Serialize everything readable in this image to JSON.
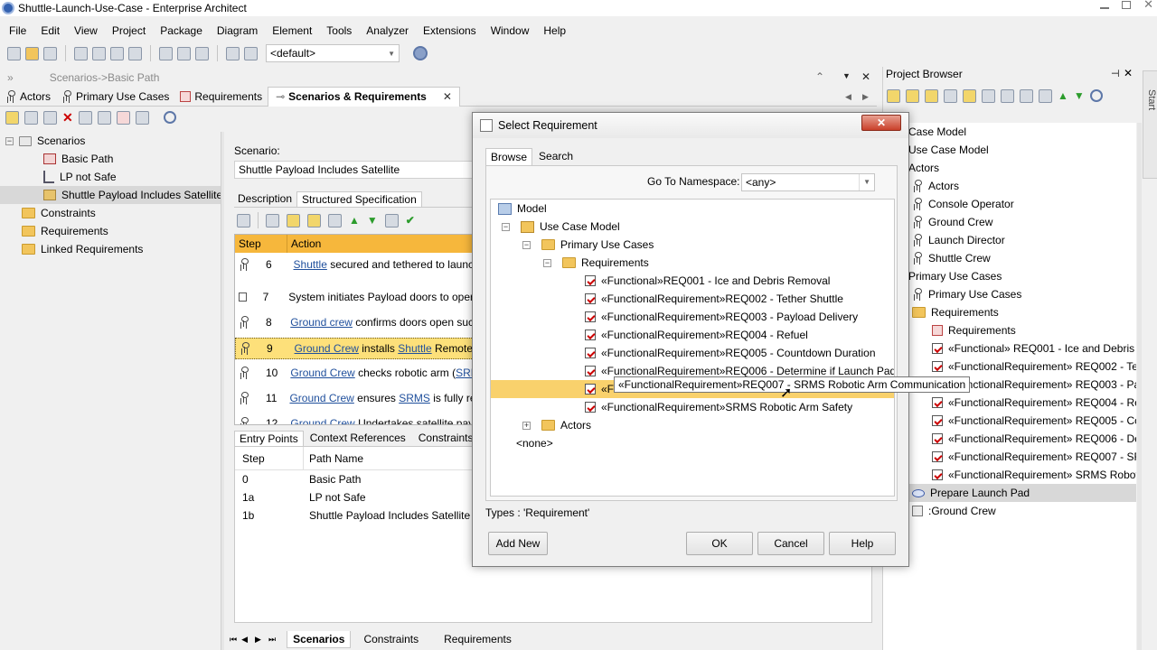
{
  "window": {
    "title": "Shuttle-Launch-Use-Case - Enterprise Architect"
  },
  "menu": [
    "File",
    "Edit",
    "View",
    "Project",
    "Package",
    "Diagram",
    "Element",
    "Tools",
    "Analyzer",
    "Extensions",
    "Window",
    "Help"
  ],
  "toolbar": {
    "perspective": "<default>"
  },
  "editor": {
    "breadcrumb": "Scenarios->Basic Path",
    "tabs": [
      "Actors",
      "Primary Use Cases",
      "Requirements",
      "Scenarios & Requirements"
    ],
    "tree": [
      "Scenarios",
      "Basic Path",
      "LP not Safe",
      "Shuttle Payload Includes Satellite",
      "Constraints",
      "Requirements",
      "Linked Requirements"
    ],
    "scenario_label": "Scenario:",
    "scenario_value": "Shuttle Payload Includes Satellite",
    "subtabs": [
      "Description",
      "Structured Specification"
    ],
    "steps_header": {
      "step": "Step",
      "action": "Action"
    },
    "steps": [
      {
        "num": "6",
        "parts": [
          "Shuttle",
          " secured and tethered to launc"
        ]
      },
      {
        "num": "7",
        "parts": [
          "",
          "System initiates Payload doors to oper"
        ]
      },
      {
        "num": "8",
        "parts": [
          "Ground crew",
          " confirms doors open suc"
        ]
      },
      {
        "num": "9",
        "parts": [
          "Ground Crew",
          " installs ",
          "Shuttle",
          " Remote"
        ]
      },
      {
        "num": "10",
        "parts": [
          "Ground Crew",
          " checks robotic arm (",
          "SRM"
        ]
      },
      {
        "num": "11",
        "parts": [
          "Ground Crew",
          " ensures ",
          "SRMS",
          " is fully ret"
        ]
      },
      {
        "num": "12",
        "parts": [
          "Ground Crew",
          " Undertakes satellite pay"
        ]
      }
    ],
    "lower_tabs": [
      "Entry Points",
      "Context References",
      "Constraints"
    ],
    "entry_header": {
      "step": "Step",
      "path": "Path Name"
    },
    "entry_rows": [
      {
        "step": "0",
        "path": "Basic Path"
      },
      {
        "step": "1a",
        "path": "LP not Safe"
      },
      {
        "step": "1b",
        "path": "Shuttle Payload Includes Satellite"
      }
    ],
    "bottom_tabs": [
      "Scenarios",
      "Constraints",
      "Requirements"
    ]
  },
  "dialog": {
    "title": "Select Requirement",
    "tabs": [
      "Browse",
      "Search"
    ],
    "namespace_label": "Go To Namespace:",
    "namespace_value": "<any>",
    "tree": {
      "model": "Model",
      "use_case_model": "Use Case Model",
      "primary_use_cases": "Primary Use Cases",
      "requirements": "Requirements",
      "items": [
        "«Functional»REQ001 - Ice and Debris Removal",
        "«FunctionalRequirement»REQ002 - Tether Shuttle",
        "«FunctionalRequirement»REQ003 - Payload Delivery",
        "«FunctionalRequirement»REQ004 - Refuel",
        "«FunctionalRequirement»REQ005 - Countdown Duration",
        "«FunctionalRequirement»REQ006 - Determine if Launch Pad is Safe",
        "«FunctionalRequirement»REQ007 - SRMS Robotic Arm Communication",
        "«FunctionalRequirement»SRMS Robotic Arm Safety"
      ],
      "actors": "Actors",
      "none": "<none>"
    },
    "selected_partial": "«Fu",
    "tooltip": "«FunctionalRequirement»REQ007 - SRMS Robotic Arm Communication",
    "types": "Types : 'Requirement'",
    "buttons": {
      "add_new": "Add New",
      "ok": "OK",
      "cancel": "Cancel",
      "help": "Help"
    }
  },
  "browser": {
    "title": "Project Browser",
    "side_tab": "Start",
    "items": [
      "Case Model",
      "Use Case Model",
      "Actors",
      "Actors",
      "Console Operator",
      "Ground Crew",
      "Launch Director",
      "Shuttle Crew",
      "Primary Use Cases",
      "Primary Use Cases",
      "Requirements",
      "Requirements",
      "«Functional» REQ001 - Ice and Debris R",
      "«FunctionalRequirement» REQ002 - Tet",
      "«FunctionalRequirement» REQ003 - Pay",
      "«FunctionalRequirement» REQ004 - Ref",
      "«FunctionalRequirement» REQ005 - Co",
      "«FunctionalRequirement» REQ006 - Det",
      "«FunctionalRequirement» REQ007 - SR",
      "«FunctionalRequirement» SRMS Roboti",
      "Prepare Launch Pad",
      ":Ground Crew"
    ]
  }
}
